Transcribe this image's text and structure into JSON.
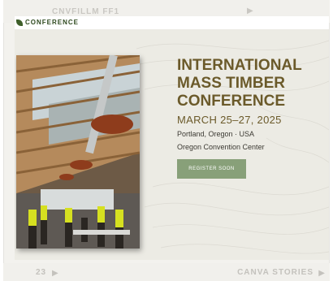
{
  "viewer": {
    "top_title": "CNVFILLM FF1",
    "page_number": "23",
    "footer_label": "CANVA STORIES"
  },
  "slide": {
    "logo_text": "CONFERENCE",
    "title": "INTERNATIONAL\nMASS TIMBER\nCONFERENCE",
    "dates": "MARCH 25–27, 2025",
    "location": "Portland, Oregon · USA",
    "venue": "Oregon Convention Center",
    "register_label": "REGISTER SOON"
  },
  "colors": {
    "title": "#6b5a2a",
    "button": "#88a079",
    "background": "#ecebe4"
  },
  "icons": [
    "arrow-icon",
    "logo-leaf-icon"
  ]
}
